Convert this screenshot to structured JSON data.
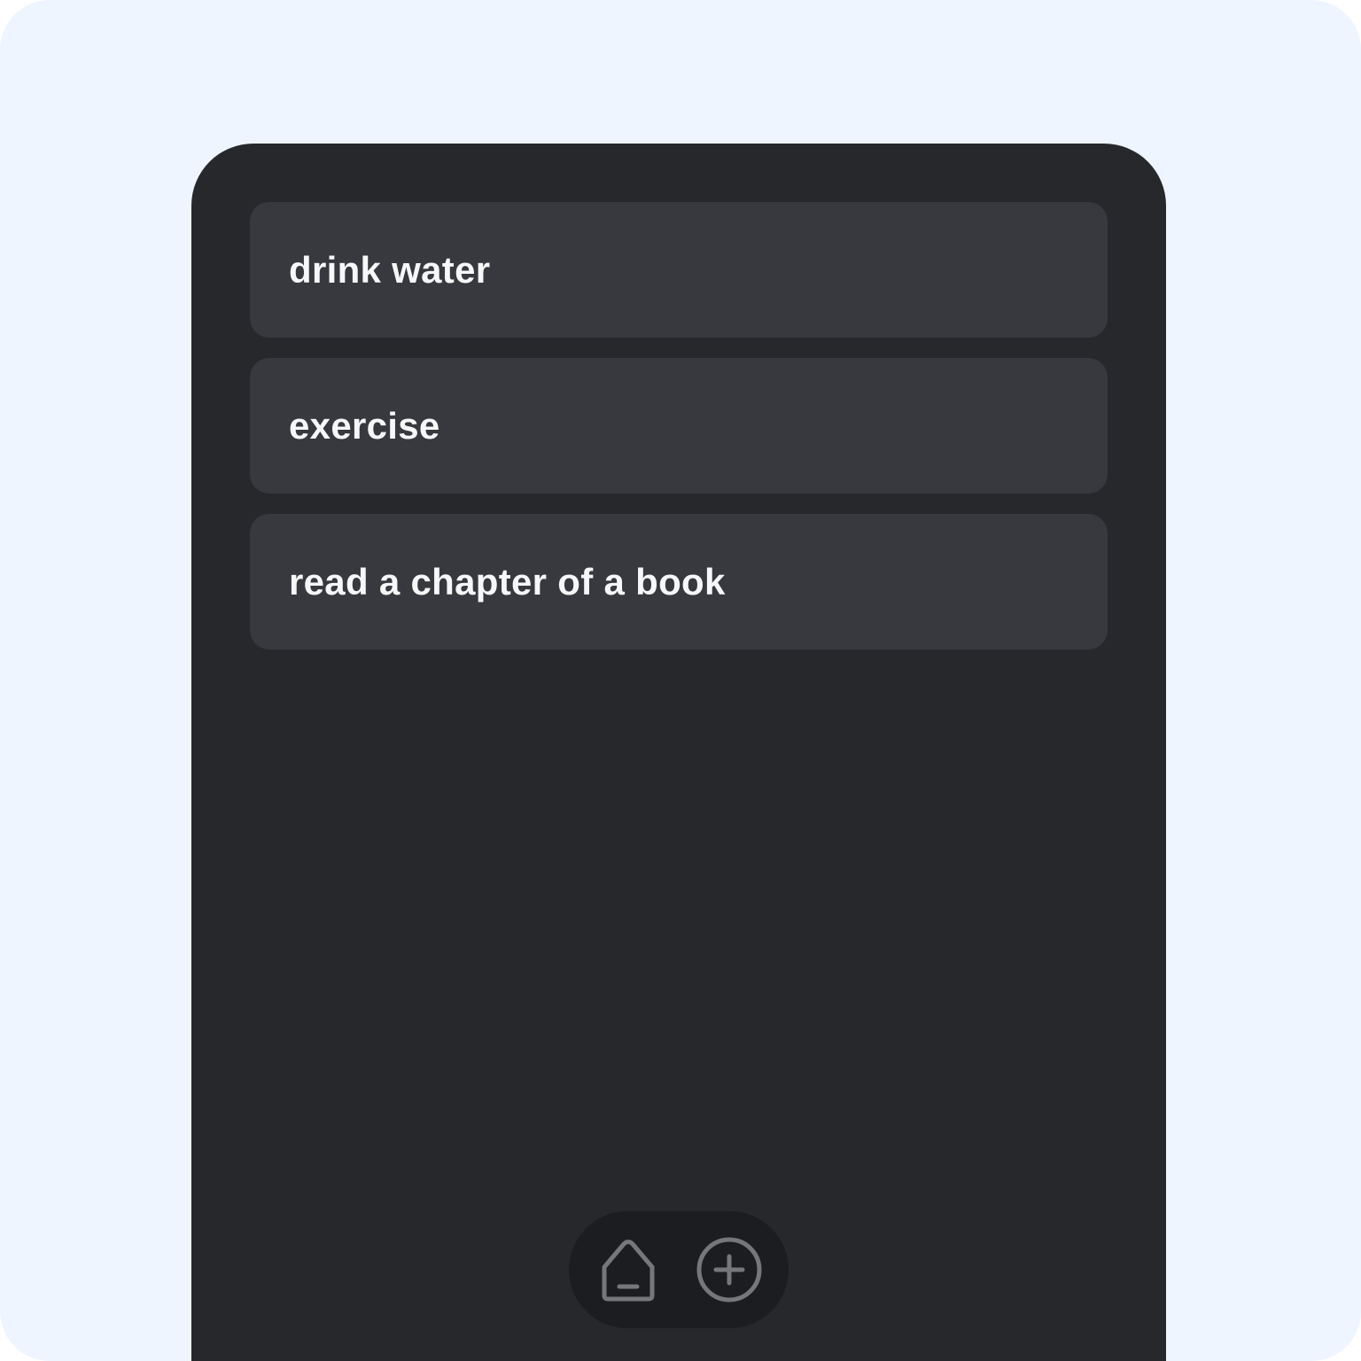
{
  "tasks": [
    {
      "label": "drink water"
    },
    {
      "label": "exercise"
    },
    {
      "label": "read a chapter of a book"
    }
  ],
  "nav": {
    "home_icon": "home-icon",
    "add_icon": "plus-circle-icon"
  },
  "colors": {
    "background": "#eef5fe",
    "screen": "#27282c",
    "card": "#38393e",
    "nav_bar": "#1c1d20",
    "icon": "#76777b",
    "text": "#f6f7f9"
  }
}
